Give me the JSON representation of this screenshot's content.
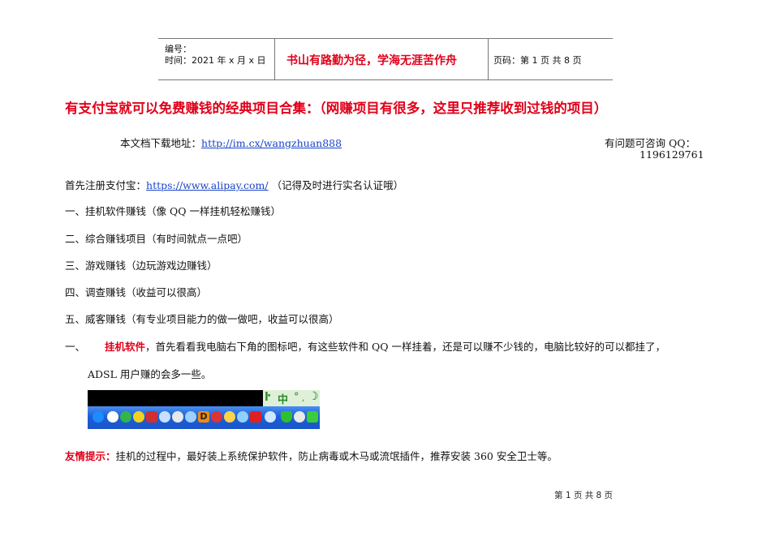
{
  "header": {
    "number_label": "编号：",
    "time_label": "时间：2021 年 x 月 x 日",
    "motto": "书山有路勤为径，学海无涯苦作舟",
    "page_code": "页码：第 1 页  共 8 页"
  },
  "title": "有支付宝就可以免费赚钱的经典项目合集：（网赚项目有很多，这里只推荐收到过钱的项目）",
  "download": {
    "label": "本文档下载地址：",
    "url": "http://im.cx/wangzhuan888"
  },
  "contact": {
    "label": "有问题可咨询 QQ：",
    "qq": "1196129761"
  },
  "register": {
    "label": "首先注册支付宝：",
    "url": "https://www.alipay.com/",
    "note": " （记得及时进行实名认证哦）"
  },
  "list": [
    "一、挂机软件赚钱（像 QQ 一样挂机轻松赚钱）",
    "二、综合赚钱项目（有时间就点一点吧）",
    "三、游戏赚钱（边玩游戏边赚钱）",
    "四、调查赚钱（收益可以很高）",
    "五、威客赚钱（有专业项目能力的做一做吧，收益可以很高）"
  ],
  "section1": {
    "num": "一、",
    "heading": "挂机软件",
    "text": "，首先看看我电脑右下角的图标吧，有这些软件和 QQ 一样挂着，还是可以赚不少钱的，电脑比较好的可以都挂了，",
    "text2": "ADSL 用户赚的会多一些。"
  },
  "tray": {
    "ime_text": "中"
  },
  "tip": {
    "label": "友情提示：",
    "text": "挂机的过程中，最好装上系统保护软件，防止病毒或木马或流氓插件，推荐安装 360 安全卫士等。"
  },
  "footer": "第 1 页 共 8 页"
}
